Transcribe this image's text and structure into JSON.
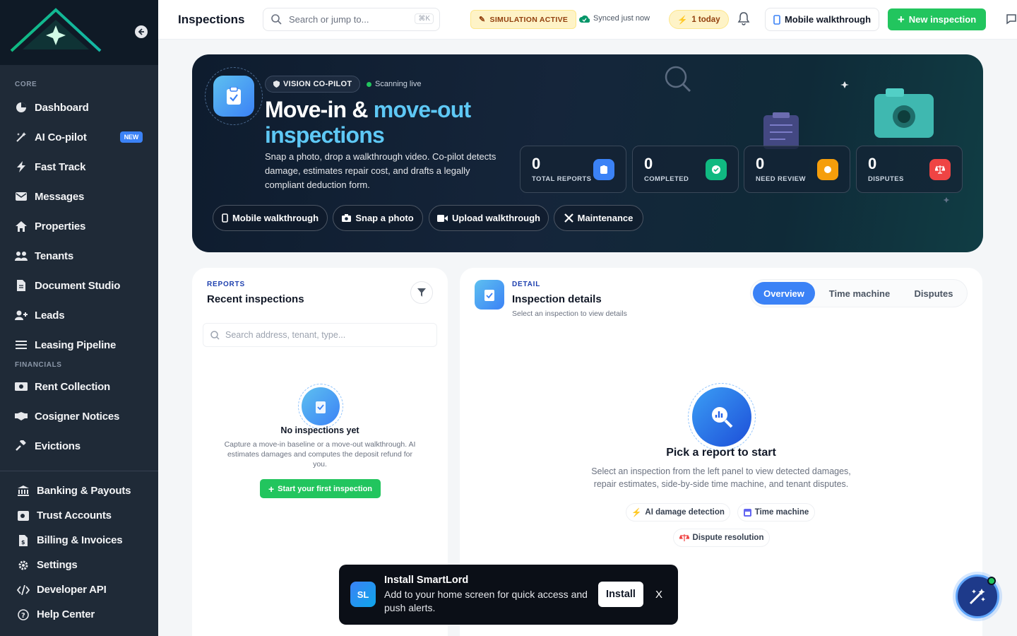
{
  "sidebar": {
    "sections": {
      "core": "CORE",
      "financials": "FINANCIALS"
    },
    "core_items": [
      {
        "label": "Dashboard",
        "icon": "dashboard-icon"
      },
      {
        "label": "AI Co-pilot",
        "icon": "magic-wand-icon",
        "badge": "NEW"
      },
      {
        "label": "Fast Track",
        "icon": "bolt-icon"
      },
      {
        "label": "Messages",
        "icon": "envelope-icon"
      },
      {
        "label": "Properties",
        "icon": "home-icon"
      },
      {
        "label": "Tenants",
        "icon": "users-icon"
      },
      {
        "label": "Document Studio",
        "icon": "document-icon"
      },
      {
        "label": "Leads",
        "icon": "user-plus-icon"
      },
      {
        "label": "Leasing Pipeline",
        "icon": "list-icon"
      }
    ],
    "financial_items": [
      {
        "label": "Rent Collection",
        "icon": "money-icon"
      },
      {
        "label": "Cosigner Notices",
        "icon": "handshake-icon"
      },
      {
        "label": "Evictions",
        "icon": "gavel-icon"
      }
    ],
    "bottom_items": [
      {
        "label": "Banking & Payouts",
        "icon": "bank-icon"
      },
      {
        "label": "Trust Accounts",
        "icon": "vault-icon"
      },
      {
        "label": "Billing & Invoices",
        "icon": "invoice-icon"
      },
      {
        "label": "Settings",
        "icon": "gear-icon"
      },
      {
        "label": "Developer API",
        "icon": "code-icon"
      },
      {
        "label": "Help Center",
        "icon": "help-icon"
      }
    ]
  },
  "topbar": {
    "title": "Inspections",
    "search_placeholder": "Search or jump to...",
    "search_shortcut": "⌘K",
    "simulation": "SIMULATION ACTIVE",
    "synced": "Synced just now",
    "today": "1 today",
    "mobile_walkthrough": "Mobile walkthrough",
    "new_inspection": "New inspection"
  },
  "hero": {
    "pill": "VISION CO-PILOT",
    "status": "Scanning live",
    "title_part1": "Move-in & ",
    "title_accent": "move-out inspections",
    "description": "Snap a photo, drop a walkthrough video. Co-pilot detects damage, estimates repair cost, and drafts a legally compliant deduction form.",
    "stats": [
      {
        "value": "0",
        "label": "TOTAL REPORTS",
        "color": "#3b82f6"
      },
      {
        "value": "0",
        "label": "COMPLETED",
        "color": "#10b981"
      },
      {
        "value": "0",
        "label": "NEED REVIEW",
        "color": "#f59e0b"
      },
      {
        "value": "0",
        "label": "DISPUTES",
        "color": "#ef4444"
      }
    ],
    "actions": [
      "Mobile walkthrough",
      "Snap a photo",
      "Upload walkthrough",
      "Maintenance"
    ]
  },
  "reports": {
    "kicker": "REPORTS",
    "title": "Recent inspections",
    "search_placeholder": "Search address, tenant, type...",
    "empty_title": "No inspections yet",
    "empty_desc": "Capture a move-in baseline or a move-out walkthrough. AI estimates damages and computes the deposit refund for you.",
    "start_button": "Start your first inspection"
  },
  "detail": {
    "kicker": "DETAIL",
    "title": "Inspection details",
    "subtitle": "Select an inspection to view details",
    "tabs": [
      "Overview",
      "Time machine",
      "Disputes"
    ],
    "active_tab": "Overview",
    "pick_title": "Pick a report to start",
    "pick_desc": "Select an inspection from the left panel to view detected damages, repair estimates, side-by-side time machine, and tenant disputes.",
    "chips": [
      "AI damage detection",
      "Time machine",
      "Dispute resolution"
    ]
  },
  "toast": {
    "logo": "SL",
    "title": "Install SmartLord",
    "message": "Add to your home screen for quick access and push alerts.",
    "install": "Install",
    "close": "X"
  },
  "colors": {
    "accent": "#22c55e",
    "primary": "#3b82f6",
    "sidebar": "#1f2a37"
  }
}
